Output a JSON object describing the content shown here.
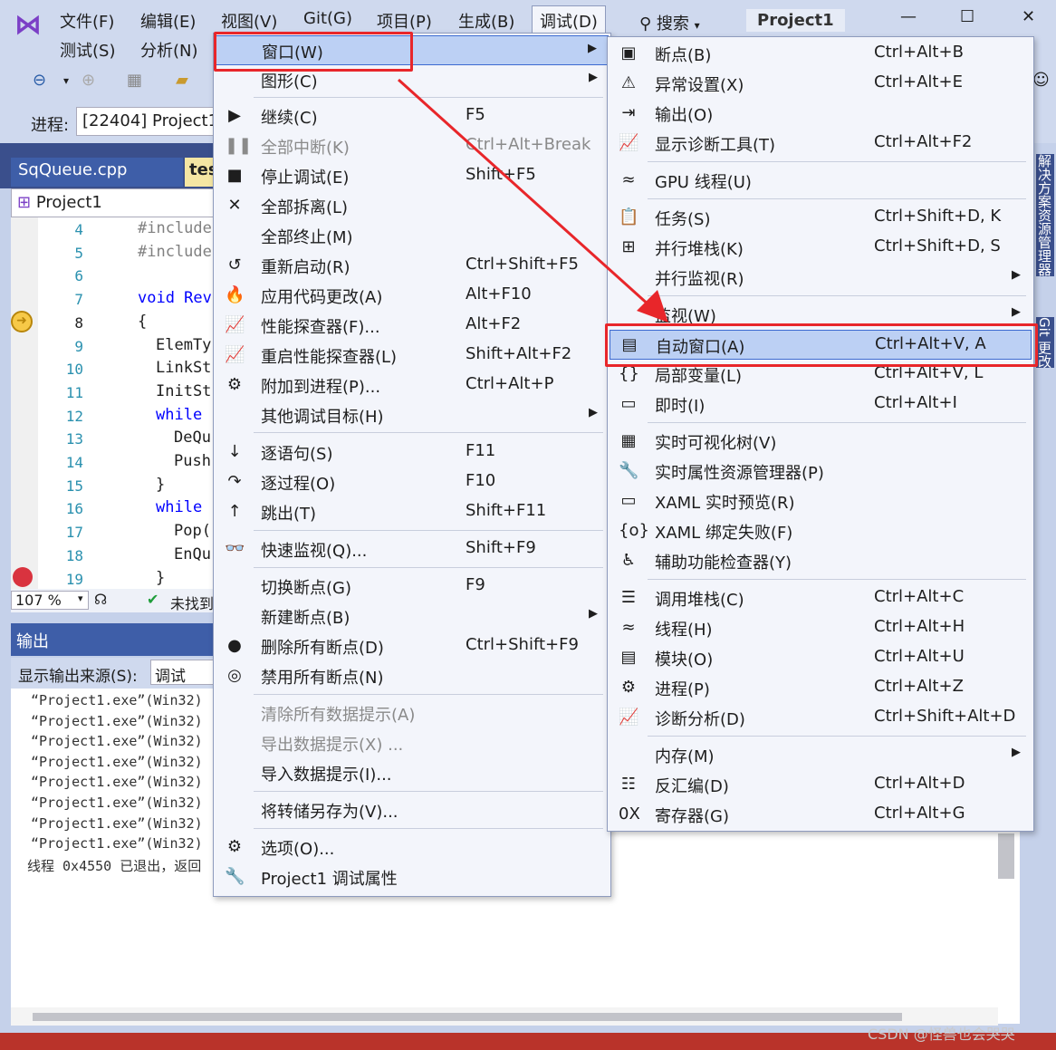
{
  "menubar": {
    "row1": [
      "文件(F)",
      "编辑(E)",
      "视图(V)",
      "Git(G)",
      "项目(P)",
      "生成(B)",
      "调试(D)"
    ],
    "row2": [
      "测试(S)",
      "分析(N)"
    ],
    "search": "搜索",
    "project_title": "Project1"
  },
  "toolbar": {
    "process_label": "进程:",
    "process_value": "[22404] Project1"
  },
  "editor": {
    "tabs": [
      "SqQueue.cpp",
      "tes"
    ],
    "nav_project": "Project1",
    "zoom": "107 %",
    "status_text": "未找到",
    "lines": [
      {
        "num": "4",
        "code": "#include"
      },
      {
        "num": "5",
        "code": "#include"
      },
      {
        "num": "6",
        "code": ""
      },
      {
        "num": "7",
        "code": "void Rev"
      },
      {
        "num": "8",
        "code": "{"
      },
      {
        "num": "9",
        "code": "ElemTy"
      },
      {
        "num": "10",
        "code": "LinkSt"
      },
      {
        "num": "11",
        "code": "InitSt"
      },
      {
        "num": "12",
        "code": "while"
      },
      {
        "num": "13",
        "code": "DeQu"
      },
      {
        "num": "14",
        "code": "Push"
      },
      {
        "num": "15",
        "code": "}"
      },
      {
        "num": "16",
        "code": "while"
      },
      {
        "num": "17",
        "code": "Pop("
      },
      {
        "num": "18",
        "code": "EnQu"
      },
      {
        "num": "19",
        "code": "}"
      }
    ]
  },
  "output": {
    "title": "输出",
    "source_label": "显示输出来源(S):",
    "source_value": "调试",
    "lines": [
      "“Project1.exe”(Win32)",
      "“Project1.exe”(Win32)",
      "“Project1.exe”(Win32)",
      "“Project1.exe”(Win32)",
      "“Project1.exe”(Win32)",
      "“Project1.exe”(Win32)",
      "“Project1.exe”(Win32)",
      "“Project1.exe”(Win32)",
      "线程 0x4550 已退出，返回"
    ]
  },
  "side_panel": {
    "label1": "解决方案资源管理器",
    "label2": "Git 更改"
  },
  "debug_menu": {
    "items": [
      {
        "label": "窗口(W)",
        "shortcut": "",
        "submenu": true,
        "icon": ""
      },
      {
        "label": "图形(C)",
        "shortcut": "",
        "submenu": true,
        "icon": ""
      },
      {
        "label": "继续(C)",
        "shortcut": "F5",
        "icon": "▶"
      },
      {
        "label": "全部中断(K)",
        "shortcut": "Ctrl+Alt+Break",
        "icon": "❚❚",
        "disabled": true
      },
      {
        "label": "停止调试(E)",
        "shortcut": "Shift+F5",
        "icon": "■"
      },
      {
        "label": "全部拆离(L)",
        "shortcut": "",
        "icon": "✕"
      },
      {
        "label": "全部终止(M)",
        "shortcut": "",
        "icon": ""
      },
      {
        "label": "重新启动(R)",
        "shortcut": "Ctrl+Shift+F5",
        "icon": "↺"
      },
      {
        "label": "应用代码更改(A)",
        "shortcut": "Alt+F10",
        "icon": "🔥"
      },
      {
        "label": "性能探查器(F)...",
        "shortcut": "Alt+F2",
        "icon": "📈"
      },
      {
        "label": "重启性能探查器(L)",
        "shortcut": "Shift+Alt+F2",
        "icon": "📈"
      },
      {
        "label": "附加到进程(P)...",
        "shortcut": "Ctrl+Alt+P",
        "icon": "⚙"
      },
      {
        "label": "其他调试目标(H)",
        "shortcut": "",
        "submenu": true,
        "icon": ""
      },
      {
        "label": "逐语句(S)",
        "shortcut": "F11",
        "icon": "↓"
      },
      {
        "label": "逐过程(O)",
        "shortcut": "F10",
        "icon": "↷"
      },
      {
        "label": "跳出(T)",
        "shortcut": "Shift+F11",
        "icon": "↑"
      },
      {
        "label": "快速监视(Q)...",
        "shortcut": "Shift+F9",
        "icon": "👓"
      },
      {
        "label": "切换断点(G)",
        "shortcut": "F9",
        "icon": ""
      },
      {
        "label": "新建断点(B)",
        "shortcut": "",
        "submenu": true,
        "icon": ""
      },
      {
        "label": "删除所有断点(D)",
        "shortcut": "Ctrl+Shift+F9",
        "icon": "●"
      },
      {
        "label": "禁用所有断点(N)",
        "shortcut": "",
        "icon": "◎"
      },
      {
        "label": "清除所有数据提示(A)",
        "shortcut": "",
        "icon": "",
        "disabled": true
      },
      {
        "label": "导出数据提示(X) ...",
        "shortcut": "",
        "icon": "",
        "disabled": true
      },
      {
        "label": "导入数据提示(I)...",
        "shortcut": "",
        "icon": ""
      },
      {
        "label": "将转储另存为(V)...",
        "shortcut": "",
        "icon": ""
      },
      {
        "label": "选项(O)...",
        "shortcut": "",
        "icon": "⚙"
      },
      {
        "label": "Project1 调试属性",
        "shortcut": "",
        "icon": "🔧"
      }
    ]
  },
  "window_submenu": {
    "items": [
      {
        "label": "断点(B)",
        "shortcut": "Ctrl+Alt+B",
        "icon": "▣"
      },
      {
        "label": "异常设置(X)",
        "shortcut": "Ctrl+Alt+E",
        "icon": "⚠"
      },
      {
        "label": "输出(O)",
        "shortcut": "",
        "icon": "⇥"
      },
      {
        "label": "显示诊断工具(T)",
        "shortcut": "Ctrl+Alt+F2",
        "icon": "📈"
      },
      {
        "label": "GPU 线程(U)",
        "shortcut": "",
        "icon": "≈"
      },
      {
        "label": "任务(S)",
        "shortcut": "Ctrl+Shift+D, K",
        "icon": "📋"
      },
      {
        "label": "并行堆栈(K)",
        "shortcut": "Ctrl+Shift+D, S",
        "icon": "⊞"
      },
      {
        "label": "并行监视(R)",
        "shortcut": "",
        "submenu": true,
        "icon": ""
      },
      {
        "label": "监视(W)",
        "shortcut": "",
        "submenu": true,
        "icon": ""
      },
      {
        "label": "自动窗口(A)",
        "shortcut": "Ctrl+Alt+V, A",
        "icon": "▤"
      },
      {
        "label": "局部变量(L)",
        "shortcut": "Ctrl+Alt+V, L",
        "icon": "{}"
      },
      {
        "label": "即时(I)",
        "shortcut": "Ctrl+Alt+I",
        "icon": "▭"
      },
      {
        "label": "实时可视化树(V)",
        "shortcut": "",
        "icon": "▦"
      },
      {
        "label": "实时属性资源管理器(P)",
        "shortcut": "",
        "icon": "🔧"
      },
      {
        "label": "XAML 实时预览(R)",
        "shortcut": "",
        "icon": "▭"
      },
      {
        "label": "XAML 绑定失败(F)",
        "shortcut": "",
        "icon": "{o}"
      },
      {
        "label": "辅助功能检查器(Y)",
        "shortcut": "",
        "icon": "♿"
      },
      {
        "label": "调用堆栈(C)",
        "shortcut": "Ctrl+Alt+C",
        "icon": "☰"
      },
      {
        "label": "线程(H)",
        "shortcut": "Ctrl+Alt+H",
        "icon": "≈"
      },
      {
        "label": "模块(O)",
        "shortcut": "Ctrl+Alt+U",
        "icon": "▤"
      },
      {
        "label": "进程(P)",
        "shortcut": "Ctrl+Alt+Z",
        "icon": "⚙"
      },
      {
        "label": "诊断分析(D)",
        "shortcut": "Ctrl+Shift+Alt+D",
        "icon": "📈"
      },
      {
        "label": "内存(M)",
        "shortcut": "",
        "submenu": true,
        "icon": ""
      },
      {
        "label": "反汇编(D)",
        "shortcut": "Ctrl+Alt+D",
        "icon": "☷"
      },
      {
        "label": "寄存器(G)",
        "shortcut": "Ctrl+Alt+G",
        "icon": "0X"
      }
    ]
  },
  "watermark": "CSDN @怪兽也会哭哭",
  "colors": {
    "accent": "#3c6ad1",
    "highlight_border": "#e8262a",
    "menu_bg": "#f3f5fb"
  }
}
